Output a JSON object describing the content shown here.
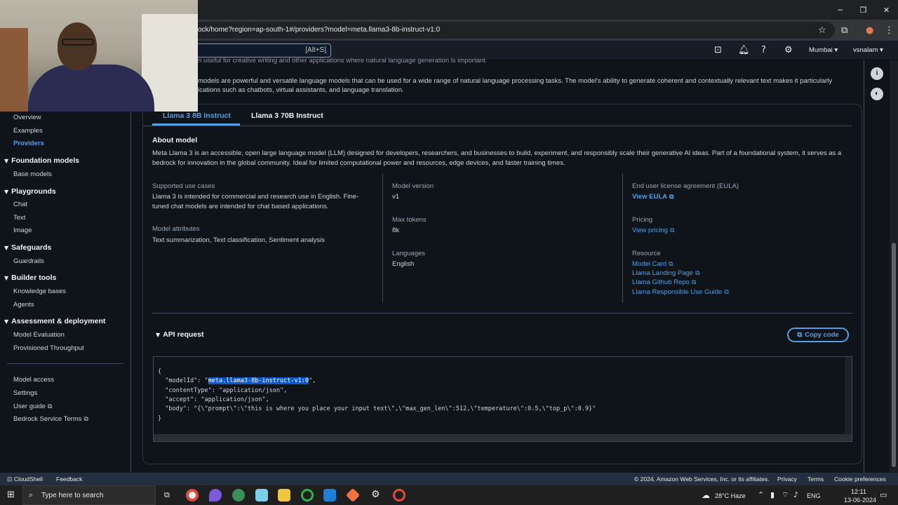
{
  "browser": {
    "url": "ock/home?region=ap-south-1#/providers?model=meta.llama3-8b-instruct-v1:0",
    "controls": {
      "minimize": "─",
      "restore": "❐",
      "close": "✕"
    }
  },
  "console_bar": {
    "search_shortcut": "[Alt+S]",
    "region": "Mumbai ▾",
    "user": "vsnalam ▾"
  },
  "sidebar": {
    "top_links": [
      {
        "label": "Overview"
      },
      {
        "label": "Examples"
      },
      {
        "label": "Providers"
      }
    ],
    "sections": [
      {
        "title": "Foundation models",
        "items": [
          "Base models"
        ]
      },
      {
        "title": "Playgrounds",
        "items": [
          "Chat",
          "Text",
          "Image"
        ]
      },
      {
        "title": "Safeguards",
        "items": [
          "Guardrails"
        ]
      },
      {
        "title": "Builder tools",
        "items": [
          "Knowledge bases",
          "Agents"
        ]
      },
      {
        "title": "Assessment & deployment",
        "items": [
          "Model Evaluation",
          "Provisioned Throughput"
        ]
      }
    ],
    "bottom_links": [
      "Model access",
      "Settings",
      "User guide",
      "Bedrock Service Terms"
    ]
  },
  "description": {
    "line1": "n useful for creative writing and other applications where natural language generation is important.",
    "line2": "models are powerful and versatile language models that can be used for a wide range of natural language processing tasks. The model's ability to generate coherent and contextually relevant text makes it particularly",
    "line3": "ications such as chatbots, virtual assistants, and language translation."
  },
  "tabs": [
    {
      "label": "Llama 3 8B Instruct",
      "active": true
    },
    {
      "label": "Llama 3 70B Instruct",
      "active": false
    }
  ],
  "about": {
    "title": "About model",
    "text": "Meta Llama 3 is an accessible, open large language model (LLM) designed for developers, researchers, and businesses to build, experiment, and responsibly scale their generative AI ideas. Part of a foundational system, it serves as a bedrock for innovation in the global community. Ideal for limited computational power and resources, edge devices, and faster training times."
  },
  "details": {
    "use_cases_label": "Supported use cases",
    "use_cases_line1": "Llama 3 is intended for commercial and research use in English. Fine-",
    "use_cases_line2": "tuned chat models are intended for chat based applications.",
    "attributes_label": "Model attributes",
    "attributes_value": "Text summarization, Text classification, Sentiment analysis",
    "version_label": "Model version",
    "version_value": "v1",
    "max_tokens_label": "Max tokens",
    "max_tokens_value": "8k",
    "languages_label": "Languages",
    "languages_value": "English",
    "eula_label": "End user license agreement (EULA)",
    "eula_link": "View EULA",
    "pricing_label": "Pricing",
    "pricing_link": "View pricing",
    "resource_label": "Resource",
    "resources": [
      "Model Card",
      "Llama Landing Page",
      "Llama Github Repo",
      "Llama Responsible Use Guide"
    ]
  },
  "api": {
    "title": "API request",
    "copy_label": "Copy code",
    "open_brace": "{",
    "model_key": "  \"modelId\": \"",
    "model_id": "meta.llama3-8b-instruct-v1:0",
    "model_end": "\",",
    "content_type": "  \"contentType\": \"application/json\",",
    "accept": "  \"accept\": \"application/json\",",
    "body": "  \"body\": \"{\\\"prompt\\\":\\\"this is where you place your input text\\\",\\\"max_gen_len\\\":512,\\\"temperature\\\":0.5,\\\"top_p\\\":0.9}\"",
    "close_brace": "}"
  },
  "footer": {
    "cloudshell": "CloudShell",
    "feedback": "Feedback",
    "copyright": "© 2024, Amazon Web Services, Inc. or its affiliates.",
    "privacy": "Privacy",
    "terms": "Terms",
    "cookies": "Cookie preferences"
  },
  "taskbar": {
    "search_placeholder": "Type here to search",
    "weather": "28°C  Haze",
    "lang": "ENG",
    "time": "12:11",
    "date": "13-06-2024"
  },
  "colors": {
    "accent": "#539fe5",
    "bg": "#0f141a",
    "highlight": "#0a57d0"
  }
}
